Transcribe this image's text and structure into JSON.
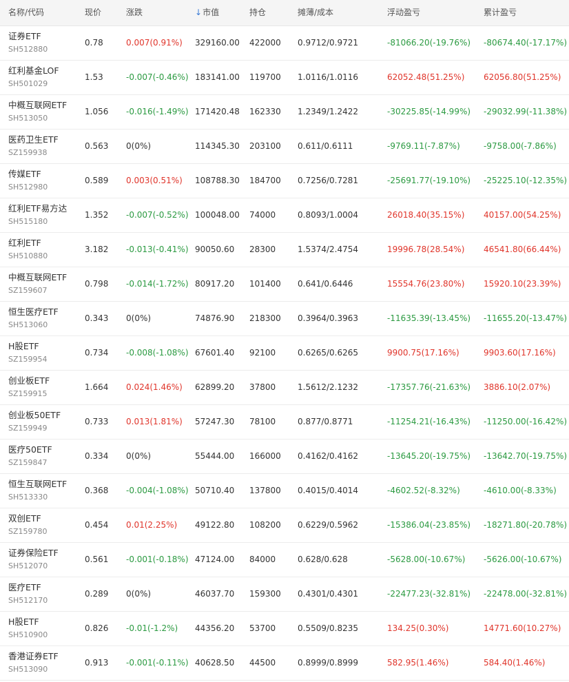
{
  "header": {
    "name": "名称/代码",
    "price": "现价",
    "change": "涨跌",
    "market_value": "市值",
    "position": "持仓",
    "cost": "摊薄/成本",
    "float_pl": "浮动盈亏",
    "total_pl": "累计盈亏"
  },
  "colors": {
    "up": "#e0352b",
    "down": "#2b9a41",
    "sort_arrow": "#3a7bd5"
  },
  "rows": [
    {
      "name": "证券ETF",
      "code": "SH512880",
      "price": "0.78",
      "change": "0.007(0.91%)",
      "change_dir": "up",
      "market_value": "329160.00",
      "position": "422000",
      "cost": "0.9712/0.9721",
      "float_pl": "-81066.20(-19.76%)",
      "float_dir": "down",
      "total_pl": "-80674.40(-17.17%)",
      "total_dir": "down"
    },
    {
      "name": "红利基金LOF",
      "code": "SH501029",
      "price": "1.53",
      "change": "-0.007(-0.46%)",
      "change_dir": "down",
      "market_value": "183141.00",
      "position": "119700",
      "cost": "1.0116/1.0116",
      "float_pl": "62052.48(51.25%)",
      "float_dir": "up",
      "total_pl": "62056.80(51.25%)",
      "total_dir": "up"
    },
    {
      "name": "中概互联网ETF",
      "code": "SH513050",
      "price": "1.056",
      "change": "-0.016(-1.49%)",
      "change_dir": "down",
      "market_value": "171420.48",
      "position": "162330",
      "cost": "1.2349/1.2422",
      "float_pl": "-30225.85(-14.99%)",
      "float_dir": "down",
      "total_pl": "-29032.99(-11.38%)",
      "total_dir": "down"
    },
    {
      "name": "医药卫生ETF",
      "code": "SZ159938",
      "price": "0.563",
      "change": "0(0%)",
      "change_dir": "flat",
      "market_value": "114345.30",
      "position": "203100",
      "cost": "0.611/0.6111",
      "float_pl": "-9769.11(-7.87%)",
      "float_dir": "down",
      "total_pl": "-9758.00(-7.86%)",
      "total_dir": "down"
    },
    {
      "name": "传媒ETF",
      "code": "SH512980",
      "price": "0.589",
      "change": "0.003(0.51%)",
      "change_dir": "up",
      "market_value": "108788.30",
      "position": "184700",
      "cost": "0.7256/0.7281",
      "float_pl": "-25691.77(-19.10%)",
      "float_dir": "down",
      "total_pl": "-25225.10(-12.35%)",
      "total_dir": "down"
    },
    {
      "name": "红利ETF易方达",
      "code": "SH515180",
      "price": "1.352",
      "change": "-0.007(-0.52%)",
      "change_dir": "down",
      "market_value": "100048.00",
      "position": "74000",
      "cost": "0.8093/1.0004",
      "float_pl": "26018.40(35.15%)",
      "float_dir": "up",
      "total_pl": "40157.00(54.25%)",
      "total_dir": "up"
    },
    {
      "name": "红利ETF",
      "code": "SH510880",
      "price": "3.182",
      "change": "-0.013(-0.41%)",
      "change_dir": "down",
      "market_value": "90050.60",
      "position": "28300",
      "cost": "1.5374/2.4754",
      "float_pl": "19996.78(28.54%)",
      "float_dir": "up",
      "total_pl": "46541.80(66.44%)",
      "total_dir": "up"
    },
    {
      "name": "中概互联网ETF",
      "code": "SZ159607",
      "price": "0.798",
      "change": "-0.014(-1.72%)",
      "change_dir": "down",
      "market_value": "80917.20",
      "position": "101400",
      "cost": "0.641/0.6446",
      "float_pl": "15554.76(23.80%)",
      "float_dir": "up",
      "total_pl": "15920.10(23.39%)",
      "total_dir": "up"
    },
    {
      "name": "恒生医疗ETF",
      "code": "SH513060",
      "price": "0.343",
      "change": "0(0%)",
      "change_dir": "flat",
      "market_value": "74876.90",
      "position": "218300",
      "cost": "0.3964/0.3963",
      "float_pl": "-11635.39(-13.45%)",
      "float_dir": "down",
      "total_pl": "-11655.20(-13.47%)",
      "total_dir": "down"
    },
    {
      "name": "H股ETF",
      "code": "SZ159954",
      "price": "0.734",
      "change": "-0.008(-1.08%)",
      "change_dir": "down",
      "market_value": "67601.40",
      "position": "92100",
      "cost": "0.6265/0.6265",
      "float_pl": "9900.75(17.16%)",
      "float_dir": "up",
      "total_pl": "9903.60(17.16%)",
      "total_dir": "up"
    },
    {
      "name": "创业板ETF",
      "code": "SZ159915",
      "price": "1.664",
      "change": "0.024(1.46%)",
      "change_dir": "up",
      "market_value": "62899.20",
      "position": "37800",
      "cost": "1.5612/2.1232",
      "float_pl": "-17357.76(-21.63%)",
      "float_dir": "down",
      "total_pl": "3886.10(2.07%)",
      "total_dir": "up"
    },
    {
      "name": "创业板50ETF",
      "code": "SZ159949",
      "price": "0.733",
      "change": "0.013(1.81%)",
      "change_dir": "up",
      "market_value": "57247.30",
      "position": "78100",
      "cost": "0.877/0.8771",
      "float_pl": "-11254.21(-16.43%)",
      "float_dir": "down",
      "total_pl": "-11250.00(-16.42%)",
      "total_dir": "down"
    },
    {
      "name": "医疗50ETF",
      "code": "SZ159847",
      "price": "0.334",
      "change": "0(0%)",
      "change_dir": "flat",
      "market_value": "55444.00",
      "position": "166000",
      "cost": "0.4162/0.4162",
      "float_pl": "-13645.20(-19.75%)",
      "float_dir": "down",
      "total_pl": "-13642.70(-19.75%)",
      "total_dir": "down"
    },
    {
      "name": "恒生互联网ETF",
      "code": "SH513330",
      "price": "0.368",
      "change": "-0.004(-1.08%)",
      "change_dir": "down",
      "market_value": "50710.40",
      "position": "137800",
      "cost": "0.4015/0.4014",
      "float_pl": "-4602.52(-8.32%)",
      "float_dir": "down",
      "total_pl": "-4610.00(-8.33%)",
      "total_dir": "down"
    },
    {
      "name": "双创ETF",
      "code": "SZ159780",
      "price": "0.454",
      "change": "0.01(2.25%)",
      "change_dir": "up",
      "market_value": "49122.80",
      "position": "108200",
      "cost": "0.6229/0.5962",
      "float_pl": "-15386.04(-23.85%)",
      "float_dir": "down",
      "total_pl": "-18271.80(-20.78%)",
      "total_dir": "down"
    },
    {
      "name": "证券保险ETF",
      "code": "SH512070",
      "price": "0.561",
      "change": "-0.001(-0.18%)",
      "change_dir": "down",
      "market_value": "47124.00",
      "position": "84000",
      "cost": "0.628/0.628",
      "float_pl": "-5628.00(-10.67%)",
      "float_dir": "down",
      "total_pl": "-5626.00(-10.67%)",
      "total_dir": "down"
    },
    {
      "name": "医疗ETF",
      "code": "SH512170",
      "price": "0.289",
      "change": "0(0%)",
      "change_dir": "flat",
      "market_value": "46037.70",
      "position": "159300",
      "cost": "0.4301/0.4301",
      "float_pl": "-22477.23(-32.81%)",
      "float_dir": "down",
      "total_pl": "-22478.00(-32.81%)",
      "total_dir": "down"
    },
    {
      "name": "H股ETF",
      "code": "SH510900",
      "price": "0.826",
      "change": "-0.01(-1.2%)",
      "change_dir": "down",
      "market_value": "44356.20",
      "position": "53700",
      "cost": "0.5509/0.8235",
      "float_pl": "134.25(0.30%)",
      "float_dir": "up",
      "total_pl": "14771.60(10.27%)",
      "total_dir": "up"
    },
    {
      "name": "香港证券ETF",
      "code": "SH513090",
      "price": "0.913",
      "change": "-0.001(-0.11%)",
      "change_dir": "down",
      "market_value": "40628.50",
      "position": "44500",
      "cost": "0.8999/0.8999",
      "float_pl": "582.95(1.46%)",
      "float_dir": "up",
      "total_pl": "584.40(1.46%)",
      "total_dir": "up"
    }
  ]
}
